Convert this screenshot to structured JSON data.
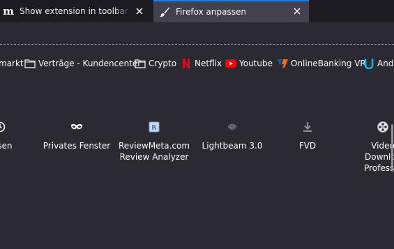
{
  "tabs": [
    {
      "favicon_text": "m",
      "title": "Show extension in toolbar - Add-ons",
      "close_icon": "close-icon"
    },
    {
      "favicon_icon": "paintbrush-icon",
      "title": "Firefox anpassen",
      "close_icon": "close-icon"
    }
  ],
  "bookmarks": [
    {
      "icon": "none",
      "label": "markt"
    },
    {
      "icon": "folder-icon",
      "label": "Verträge - Kundencenter"
    },
    {
      "icon": "folder-icon",
      "label": "Crypto"
    },
    {
      "icon": "netflix-icon",
      "label": "Netflix"
    },
    {
      "icon": "youtube-icon",
      "label": "Youtube"
    },
    {
      "icon": "volksbank-icon",
      "label": "OnlineBanking VR"
    },
    {
      "icon": "udacity-icon",
      "label": "And"
    }
  ],
  "palette": [
    {
      "icon": "history-icon",
      "line1": "essen",
      "line2": ""
    },
    {
      "icon": "private-mask-icon",
      "line1": "Privates Fenster",
      "line2": ""
    },
    {
      "icon": "reviewmeta-icon",
      "line1": "ReviewMeta.com",
      "line2": "Review Analyzer"
    },
    {
      "icon": "lightbeam-icon",
      "line1": "Lightbeam 3.0",
      "line2": ""
    },
    {
      "icon": "download-icon",
      "line1": "FVD",
      "line2": ""
    },
    {
      "icon": "film-reel-icon",
      "line1": "Video",
      "line2": "Downloa",
      "line3": "Professio"
    }
  ],
  "colors": {
    "tab_strip": "#1c1b22",
    "toolbar": "#2b2a33",
    "selected_tab": "#42414d",
    "accent": "#0a84ff",
    "netflix": "#e50914",
    "youtube": "#ff0000",
    "volksbank": "#0066b3",
    "udacity": "#02b3e4"
  }
}
